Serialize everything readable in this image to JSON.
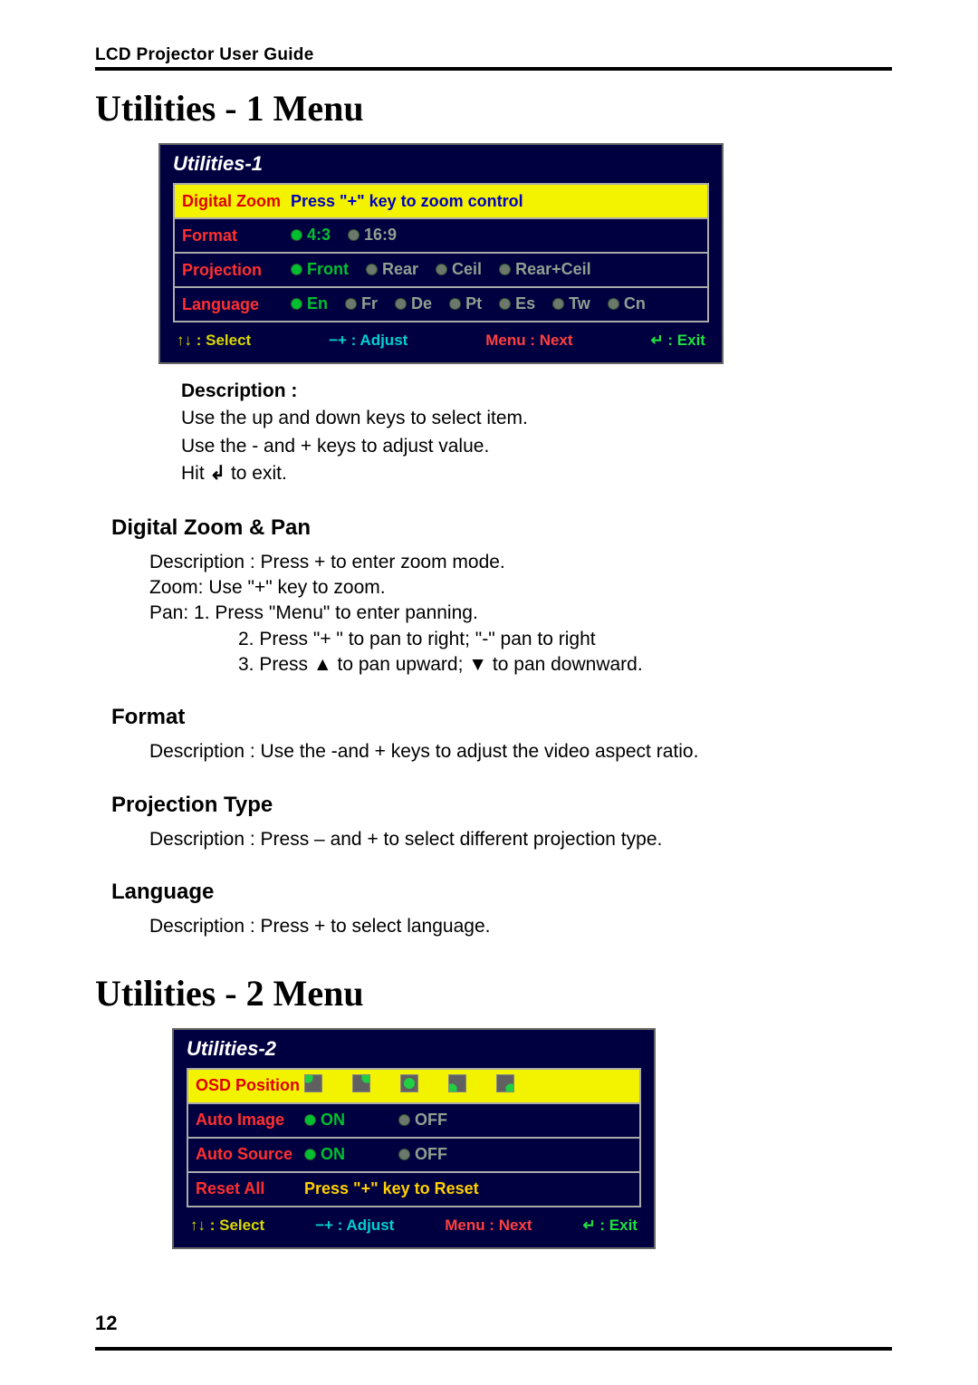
{
  "runhead": "LCD Projector User Guide",
  "h1a": "Utilities   - 1 Menu",
  "h1b": "Utilities - 2 Menu",
  "page_number": "12",
  "osd1": {
    "title": "Utilities-1",
    "rows": {
      "dz": {
        "label": "Digital Zoom",
        "value": "Press \"+\" key to zoom control"
      },
      "fmt": {
        "label": "Format",
        "o1": "4:3",
        "o2": "16:9"
      },
      "proj": {
        "label": "Projection",
        "o1": "Front",
        "o2": "Rear",
        "o3": "Ceil",
        "o4": "Rear+Ceil"
      },
      "lang": {
        "label": "Language",
        "o1": "En",
        "o2": "Fr",
        "o3": "De",
        "o4": "Pt",
        "o5": "Es",
        "o6": "Tw",
        "o7": "Cn"
      }
    },
    "footer": {
      "select": "↑↓ : Select",
      "adjust": "−+ : Adjust",
      "next": "Menu : Next",
      "exit": "↵ : Exit"
    }
  },
  "desc": {
    "heading": "Description :",
    "l1": "Use the up and down keys to select item.",
    "l2": "Use the - and + keys to adjust value.",
    "l3a": "Hit ",
    "l3b": "↲",
    "l3c": " to exit."
  },
  "dzpan": {
    "heading": "Digital Zoom & Pan",
    "l1": "Description : Press + to enter zoom mode.",
    "l2": "Zoom: Use \"+\" key to zoom.",
    "l3": "Pan: 1. Press \"Menu\" to enter panning.",
    "l4": "2. Press \"+ \" to pan to right; \"-\" pan to right",
    "l5a": "3. Press ",
    "l5b": "▲",
    "l5c": " to pan upward; ",
    "l5d": "▼",
    "l5e": " to pan downward."
  },
  "fmt": {
    "heading": "Format",
    "l1": "Description : Use the -and + keys to adjust the video aspect ratio."
  },
  "projtype": {
    "heading": "Projection Type",
    "l1": "Description : Press – and + to select different projection type."
  },
  "lang": {
    "heading": "Language",
    "l1": "Description : Press + to select language."
  },
  "osd2": {
    "title": "Utilities-2",
    "rows": {
      "pos": {
        "label": "OSD Position"
      },
      "aimg": {
        "label": "Auto Image",
        "o1": "ON",
        "o2": "OFF"
      },
      "asrc": {
        "label": "Auto Source",
        "o1": "ON",
        "o2": "OFF"
      },
      "reset": {
        "label": "Reset All",
        "value": "Press \"+\" key to Reset"
      }
    },
    "footer": {
      "select": "↑↓ : Select",
      "adjust": "−+ : Adjust",
      "next": "Menu : Next",
      "exit": "↵ : Exit"
    }
  }
}
